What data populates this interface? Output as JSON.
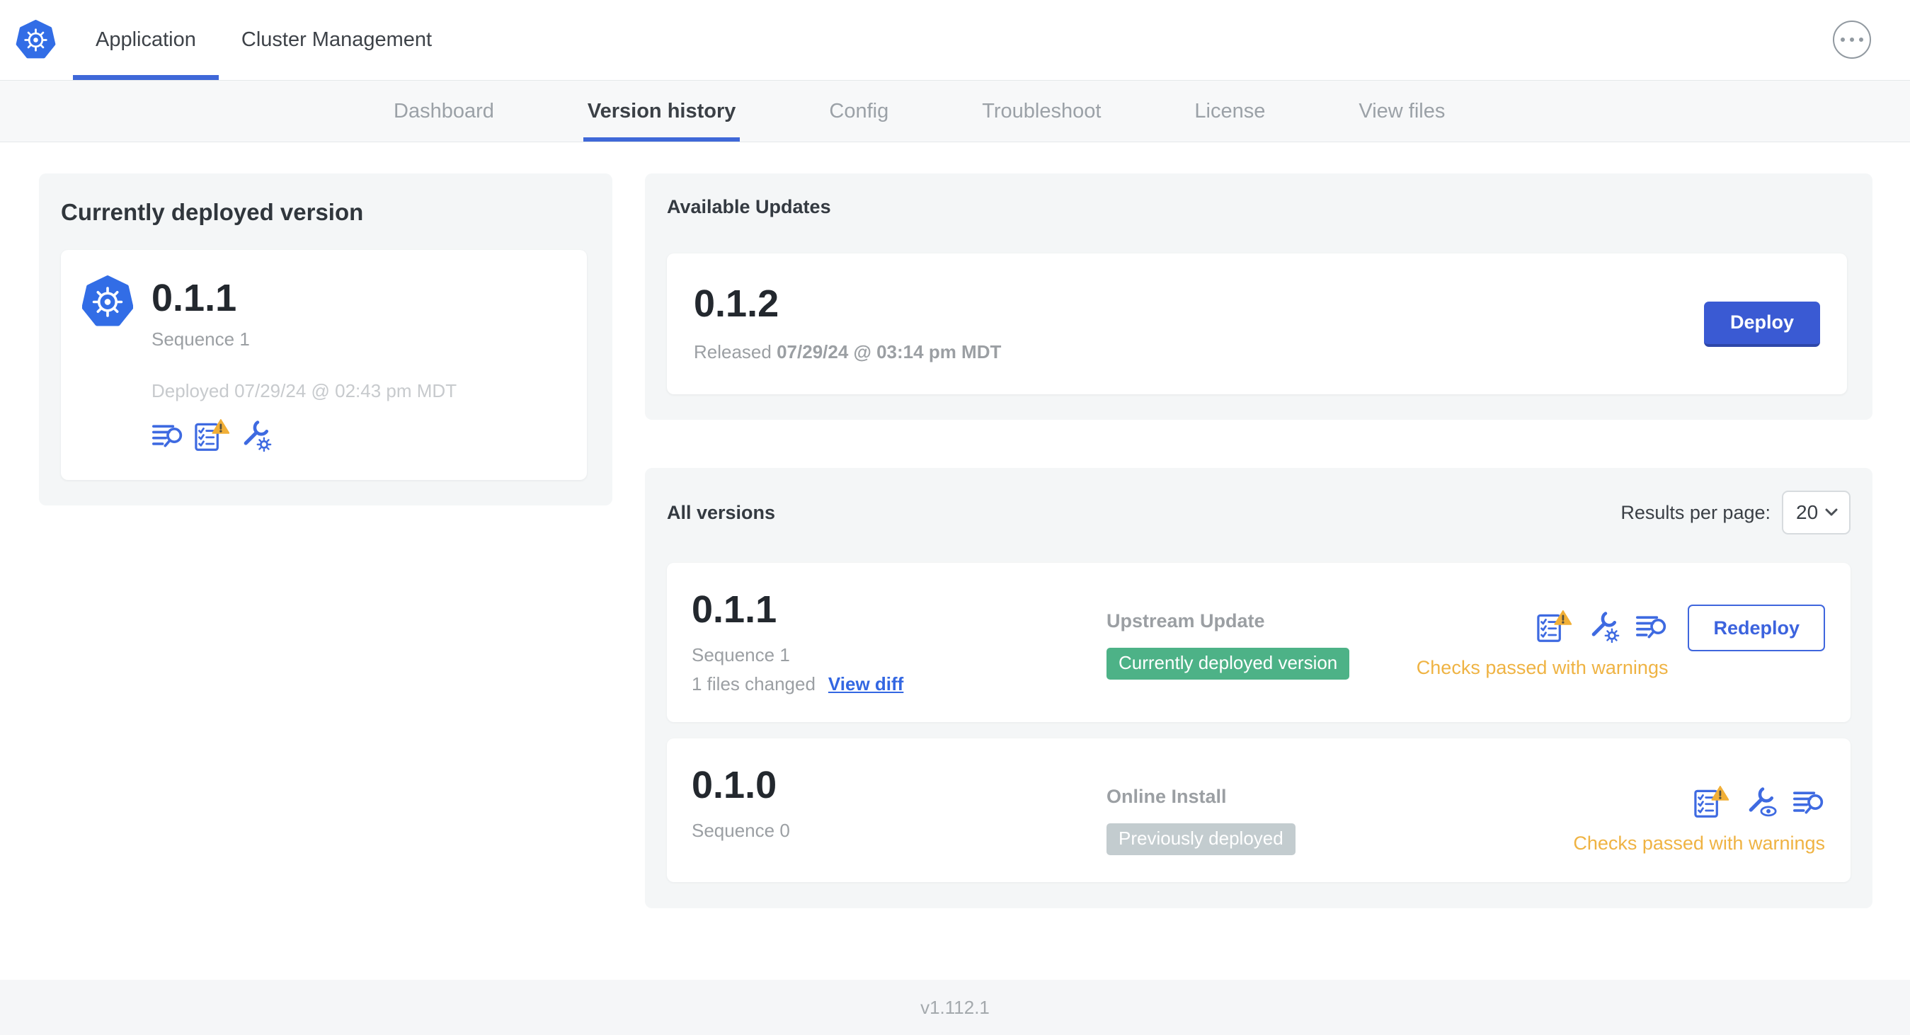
{
  "header": {
    "tabs": [
      {
        "label": "Application",
        "active": true
      },
      {
        "label": "Cluster Management",
        "active": false
      }
    ],
    "more_menu_icon": "ellipsis-icon"
  },
  "subnav": {
    "tabs": [
      {
        "label": "Dashboard",
        "active": false
      },
      {
        "label": "Version history",
        "active": true
      },
      {
        "label": "Config",
        "active": false
      },
      {
        "label": "Troubleshoot",
        "active": false
      },
      {
        "label": "License",
        "active": false
      },
      {
        "label": "View files",
        "active": false
      }
    ]
  },
  "current_version": {
    "title": "Currently deployed version",
    "version": "0.1.1",
    "sequence": "Sequence 1",
    "deployed_text": "Deployed 07/29/24 @ 02:43 pm MDT"
  },
  "available_updates": {
    "title": "Available Updates",
    "version": "0.1.2",
    "released_prefix": "Released",
    "released_timestamp": "07/29/24 @ 03:14 pm MDT",
    "deploy_label": "Deploy"
  },
  "all_versions": {
    "title": "All versions",
    "results_per_page_label": "Results per page:",
    "results_per_page_value": "20",
    "rows": [
      {
        "version": "0.1.1",
        "sequence": "Sequence 1",
        "files_changed": "1 files changed",
        "view_diff_label": "View diff",
        "source": "Upstream Update",
        "badge": "Currently deployed version",
        "badge_type": "green",
        "status": "Checks passed with warnings",
        "action_label": "Redeploy"
      },
      {
        "version": "0.1.0",
        "sequence": "Sequence 0",
        "source": "Online Install",
        "badge": "Previously deployed",
        "badge_type": "gray",
        "status": "Checks passed with warnings"
      }
    ]
  },
  "footer": {
    "app_version": "v1.112.1"
  },
  "colors": {
    "accent_blue": "#3f68d8",
    "icon_blue": "#3e6ae1",
    "deploy_button_blue": "#3a5ad3",
    "green_badge": "#4db287",
    "gray_badge": "#c3cccf",
    "warning_orange": "#efb343",
    "panel_gray": "#f4f6f7",
    "k8s_logo_blue": "#326de6"
  },
  "icons": {
    "brand": "kubernetes-logo-icon",
    "logs": "view-logs-icon",
    "preflight": "preflight-checks-icon",
    "preflight_warning": "warning-triangle-icon",
    "edit_config": "edit-config-wrench-gear-icon",
    "view_config": "view-config-wrench-eye-icon",
    "select_chevron": "chevron-down-icon"
  }
}
